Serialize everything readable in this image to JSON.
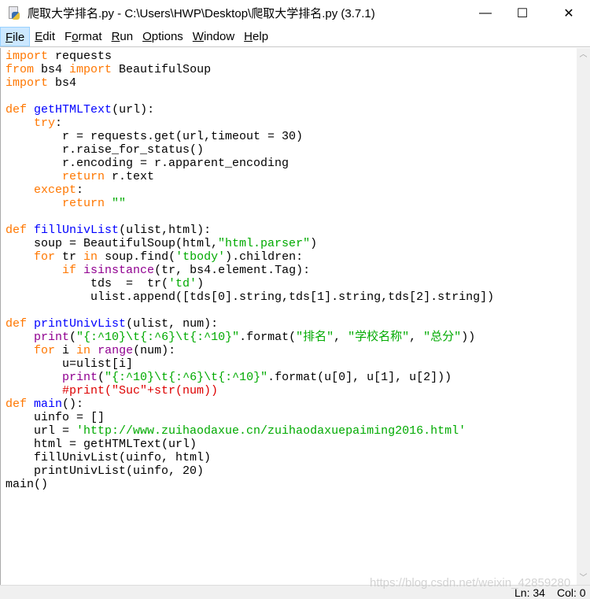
{
  "window": {
    "title": "爬取大学排名.py - C:\\Users\\HWP\\Desktop\\爬取大学排名.py (3.7.1)",
    "minimize": "—",
    "maximize": "☐",
    "close": "✕"
  },
  "menu": [
    {
      "u": "F",
      "rest": "ile"
    },
    {
      "u": "E",
      "rest": "dit"
    },
    {
      "pre": "F",
      "u": "o",
      "rest": "rmat"
    },
    {
      "u": "R",
      "rest": "un"
    },
    {
      "u": "O",
      "rest": "ptions"
    },
    {
      "u": "W",
      "rest": "indow"
    },
    {
      "u": "H",
      "rest": "elp"
    }
  ],
  "code": [
    [
      [
        "k",
        "import"
      ],
      [
        "n",
        " requests"
      ]
    ],
    [
      [
        "k",
        "from"
      ],
      [
        "n",
        " bs4 "
      ],
      [
        "k",
        "import"
      ],
      [
        "n",
        " BeautifulSoup"
      ]
    ],
    [
      [
        "k",
        "import"
      ],
      [
        "n",
        " bs4"
      ]
    ],
    [],
    [
      [
        "k",
        "def"
      ],
      [
        "n",
        " "
      ],
      [
        "d",
        "getHTMLText"
      ],
      [
        "n",
        "(url):"
      ]
    ],
    [
      [
        "n",
        "    "
      ],
      [
        "k",
        "try"
      ],
      [
        "n",
        ":"
      ]
    ],
    [
      [
        "n",
        "        r = requests.get(url,timeout = 30)"
      ]
    ],
    [
      [
        "n",
        "        r.raise_for_status()"
      ]
    ],
    [
      [
        "n",
        "        r.encoding = r.apparent_encoding"
      ]
    ],
    [
      [
        "n",
        "        "
      ],
      [
        "k",
        "return"
      ],
      [
        "n",
        " r.text"
      ]
    ],
    [
      [
        "n",
        "    "
      ],
      [
        "k",
        "except"
      ],
      [
        "n",
        ":"
      ]
    ],
    [
      [
        "n",
        "        "
      ],
      [
        "k",
        "return"
      ],
      [
        "n",
        " "
      ],
      [
        "s",
        "\"\""
      ]
    ],
    [],
    [
      [
        "k",
        "def"
      ],
      [
        "n",
        " "
      ],
      [
        "d",
        "fillUnivList"
      ],
      [
        "n",
        "(ulist,html):"
      ]
    ],
    [
      [
        "n",
        "    soup = BeautifulSoup(html,"
      ],
      [
        "s",
        "\"html.parser\""
      ],
      [
        "n",
        ")"
      ]
    ],
    [
      [
        "n",
        "    "
      ],
      [
        "k",
        "for"
      ],
      [
        "n",
        " tr "
      ],
      [
        "k",
        "in"
      ],
      [
        "n",
        " soup.find("
      ],
      [
        "s",
        "'tbody'"
      ],
      [
        "n",
        ").children:"
      ]
    ],
    [
      [
        "n",
        "        "
      ],
      [
        "k",
        "if"
      ],
      [
        "n",
        " "
      ],
      [
        "b",
        "isinstance"
      ],
      [
        "n",
        "(tr, bs4.element.Tag):"
      ]
    ],
    [
      [
        "n",
        "            tds  =  tr("
      ],
      [
        "s",
        "'td'"
      ],
      [
        "n",
        ")"
      ]
    ],
    [
      [
        "n",
        "            ulist.append([tds[0].string,tds[1].string,tds[2].string])"
      ]
    ],
    [],
    [
      [
        "k",
        "def"
      ],
      [
        "n",
        " "
      ],
      [
        "d",
        "printUnivList"
      ],
      [
        "n",
        "(ulist, num):"
      ]
    ],
    [
      [
        "n",
        "    "
      ],
      [
        "b",
        "print"
      ],
      [
        "n",
        "("
      ],
      [
        "s",
        "\"{:^10}\\t{:^6}\\t{:^10}\""
      ],
      [
        "n",
        ".format("
      ],
      [
        "s",
        "\"排名\""
      ],
      [
        "n",
        ", "
      ],
      [
        "s",
        "\"学校名称\""
      ],
      [
        "n",
        ", "
      ],
      [
        "s",
        "\"总分\""
      ],
      [
        "n",
        "))"
      ]
    ],
    [
      [
        "n",
        "    "
      ],
      [
        "k",
        "for"
      ],
      [
        "n",
        " i "
      ],
      [
        "k",
        "in"
      ],
      [
        "n",
        " "
      ],
      [
        "b",
        "range"
      ],
      [
        "n",
        "(num):"
      ]
    ],
    [
      [
        "n",
        "        u=ulist[i]"
      ]
    ],
    [
      [
        "n",
        "        "
      ],
      [
        "b",
        "print"
      ],
      [
        "n",
        "("
      ],
      [
        "s",
        "\"{:^10}\\t{:^6}\\t{:^10}\""
      ],
      [
        "n",
        ".format(u[0], u[1], u[2]))"
      ]
    ],
    [
      [
        "n",
        "        "
      ],
      [
        "c",
        "#print(\"Suc\"+str(num))"
      ]
    ],
    [
      [
        "k",
        "def"
      ],
      [
        "n",
        " "
      ],
      [
        "d",
        "main"
      ],
      [
        "n",
        "():"
      ]
    ],
    [
      [
        "n",
        "    uinfo = []"
      ]
    ],
    [
      [
        "n",
        "    url = "
      ],
      [
        "s",
        "'http://www.zuihaodaxue.cn/zuihaodaxuepaiming2016.html'"
      ]
    ],
    [
      [
        "n",
        "    html = getHTMLText(url)"
      ]
    ],
    [
      [
        "n",
        "    fillUnivList(uinfo, html)"
      ]
    ],
    [
      [
        "n",
        "    printUnivList(uinfo, 20)"
      ]
    ],
    [
      [
        "n",
        "main()"
      ]
    ]
  ],
  "status": {
    "line": "Ln: 34",
    "col": "Col: 0"
  },
  "watermark": "https://blog.csdn.net/weixin_42859280"
}
